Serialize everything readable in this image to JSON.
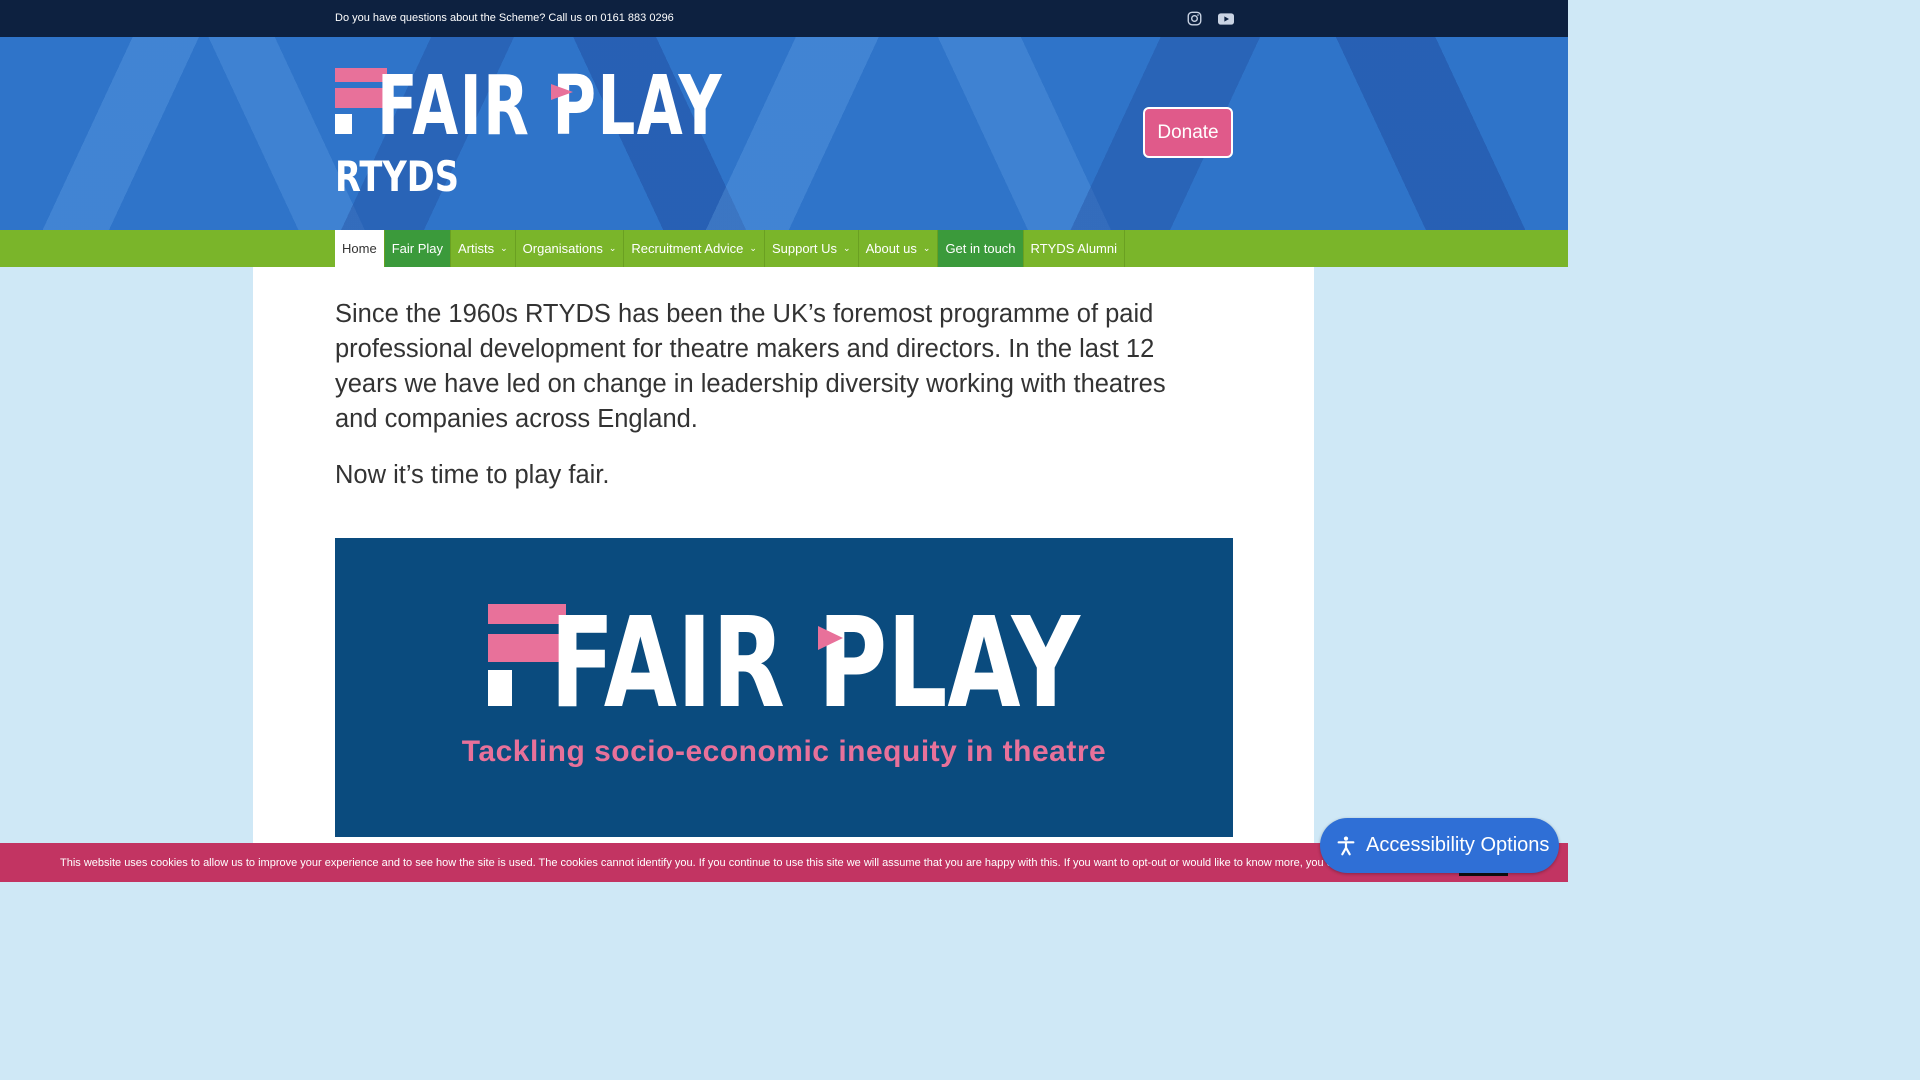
{
  "topbar": {
    "message": "Do you have questions about the Scheme? Call us on 0161 883 0296",
    "social": [
      "instagram-icon",
      "youtube-icon"
    ]
  },
  "header": {
    "logo_text_line1": "FAIR PLAY",
    "logo_text_line2": "RTYDS",
    "donate_label": "Donate"
  },
  "nav": {
    "items": [
      {
        "label": "Home",
        "has_dropdown": false
      },
      {
        "label": "Fair Play",
        "has_dropdown": false
      },
      {
        "label": "Artists",
        "has_dropdown": true
      },
      {
        "label": "Organisations",
        "has_dropdown": true
      },
      {
        "label": "Recruitment Advice",
        "has_dropdown": true
      },
      {
        "label": "Support Us",
        "has_dropdown": true
      },
      {
        "label": "About us",
        "has_dropdown": true
      },
      {
        "label": "Get in touch",
        "has_dropdown": false
      },
      {
        "label": "RTYDS Alumni",
        "has_dropdown": false
      }
    ]
  },
  "main": {
    "intro": "Since the 1960s RTYDS has been the UK’s foremost programme of paid professional development for theatre makers and directors. In the last 12 years we have led on change in leadership diversity working with theatres and companies across England.",
    "tagline": "Now it’s time to play fair.",
    "banner": {
      "logo_text": "FAIR PLAY",
      "subtitle": "Tackling socio-economic inequity in theatre"
    }
  },
  "cookie": {
    "text": "This website uses cookies to allow us to improve your experience and to see how the site is used. The cookies cannot identify you. If you continue to use this site we will assume that you are happy with this. If you want to opt-out or would like to know more, you can"
  },
  "accessibility": {
    "label": "Accessibility Options"
  },
  "colors": {
    "topbar": "#0d2140",
    "header_blue": "#2f74c9",
    "nav_green": "#7ab52a",
    "nav_dark_green": "#3b9a3b",
    "donate_pink": "#e05a8a",
    "banner_navy": "#0a4b7e",
    "brand_pink": "#e8719a",
    "cookie_bar": "#c23462",
    "a11y_blue": "#2f6fd6"
  }
}
